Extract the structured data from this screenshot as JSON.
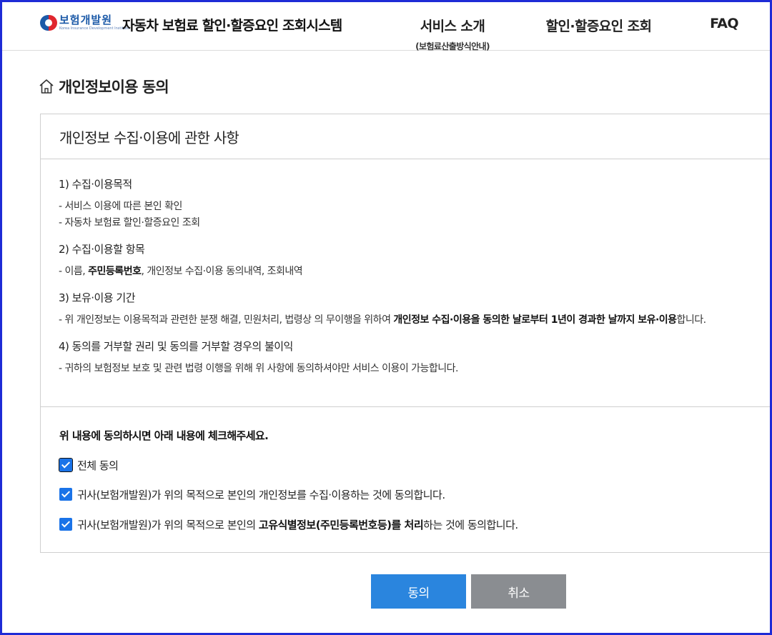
{
  "header": {
    "logo_text": "보험개발원",
    "logo_sub": "Korea Insurance Development Institute",
    "site_title": "자동차 보험료 할인·할증요인 조회시스템",
    "nav": [
      {
        "label": "서비스 소개",
        "sub": "(보험료산출방식안내)"
      },
      {
        "label": "할인·할증요인 조회",
        "sub": ""
      },
      {
        "label": "FAQ",
        "sub": ""
      }
    ]
  },
  "page": {
    "title": "개인정보이용 동의"
  },
  "panel": {
    "heading": "개인정보 수집·이용에 관한 사항",
    "sections": [
      {
        "title": "1) 수집·이용목적",
        "lines": [
          "- 서비스 이용에 따른 본인 확인",
          "- 자동차 보험료 할인·할증요인 조회"
        ]
      },
      {
        "title": "2) 수집·이용할 항목",
        "line_pre": "- 이름, ",
        "line_bold": "주민등록번호",
        "line_post": ", 개인정보 수집·이용 동의내역, 조회내역"
      },
      {
        "title": "3) 보유·이용 기간",
        "line_pre": "- 위 개인정보는 이용목적과 관련한 분쟁 해결, 민원처리, 법령상 의 무이행을 위하여 ",
        "line_bold": "개인정보 수집·이용을 동의한 날로부터 1년이 경과한 날까지 보유·이용",
        "line_post": "합니다."
      },
      {
        "title": "4) 동의를 거부할 권리 및 동의를 거부할 경우의 불이익",
        "lines": [
          "- 귀하의 보험정보 보호 및 관련 법령 이행을 위해 위 사항에 동의하셔야만 서비스 이용이 가능합니다."
        ]
      }
    ],
    "consent_question": "위 내용에 동의하시면 아래 내용에 체크해주세요.",
    "checkboxes": {
      "all": {
        "label": "전체 동의",
        "checked": true
      },
      "collect": {
        "label": "귀사(보험개발원)가 위의 목적으로 본인의 개인정보를 수집·이용하는 것에 동의합니다.",
        "checked": true
      },
      "unique_pre": "귀사(보험개발원)가 위의 목적으로 본인의 ",
      "unique_bold": "고유식별정보(주민등록번호등)를 처리",
      "unique_post": "하는 것에 동의합니다.",
      "unique_checked": true
    }
  },
  "buttons": {
    "agree": "동의",
    "cancel": "취소"
  },
  "colors": {
    "frame": "#1e2bd6",
    "checkbox": "#1a73e8",
    "agree_button": "#2a85de",
    "cancel_button": "#8a8d91"
  }
}
